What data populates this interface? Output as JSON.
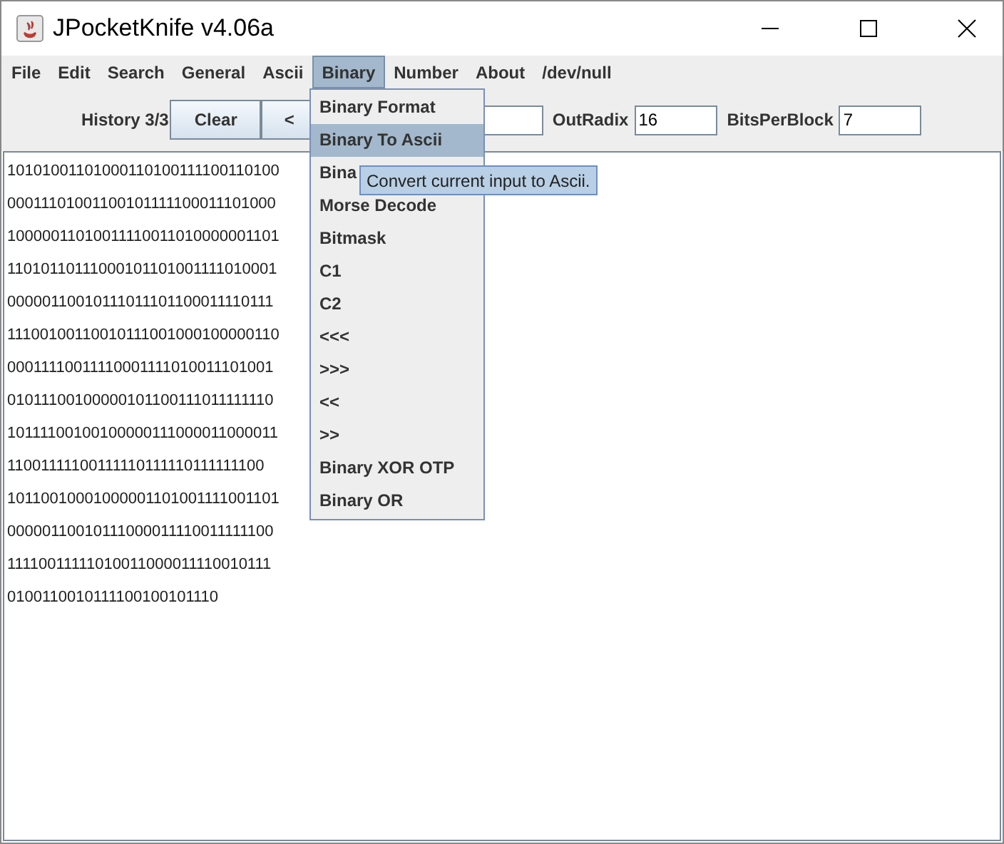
{
  "window": {
    "title": "JPocketKnife v4.06a"
  },
  "menu_bar": [
    {
      "label": "File",
      "selected": false
    },
    {
      "label": "Edit",
      "selected": false
    },
    {
      "label": "Search",
      "selected": false
    },
    {
      "label": "General",
      "selected": false
    },
    {
      "label": "Ascii",
      "selected": false
    },
    {
      "label": "Binary",
      "selected": true
    },
    {
      "label": "Number",
      "selected": false
    },
    {
      "label": "About",
      "selected": false
    },
    {
      "label": "/dev/null",
      "selected": false
    }
  ],
  "toolbar": {
    "history": "History 3/3",
    "clear_button": "Clear",
    "back_button": "<",
    "out_radix": {
      "label": "OutRadix",
      "value": "16"
    },
    "bits_per_block": {
      "label": "BitsPerBlock",
      "value": "7"
    }
  },
  "text_area": [
    "10101001101000110100111100110100",
    "00011101001100101111100011101000",
    "10000011010011110011010000001101",
    "11010110111000101101001111010001",
    "00000110010111011101100011110111",
    "11100100110010111001000100000110",
    "00011110011110001111010011101001",
    "01011100100000101100111011111110",
    "10111100100100000111000011000011",
    "11001111100111110111110111111100",
    "10110010001000001101001111001101",
    "00000110010111000011110011111100",
    "11110011111010011000011110010111",
    "0100110010111100100101110"
  ],
  "dropdown_menu": [
    {
      "label": "Binary Format",
      "selected": false
    },
    {
      "label": "Binary To Ascii",
      "selected": true
    },
    {
      "label": "Bina",
      "selected": false
    },
    {
      "label": "Morse Decode",
      "selected": false
    },
    {
      "label": "Bitmask",
      "selected": false
    },
    {
      "label": "C1",
      "selected": false
    },
    {
      "label": "C2",
      "selected": false
    },
    {
      "label": "<<<",
      "selected": false
    },
    {
      "label": ">>>",
      "selected": false
    },
    {
      "label": "<<",
      "selected": false
    },
    {
      "label": ">>",
      "selected": false
    },
    {
      "label": "Binary XOR OTP",
      "selected": false
    },
    {
      "label": "Binary OR",
      "selected": false
    }
  ],
  "tooltip": "Convert current input to Ascii."
}
